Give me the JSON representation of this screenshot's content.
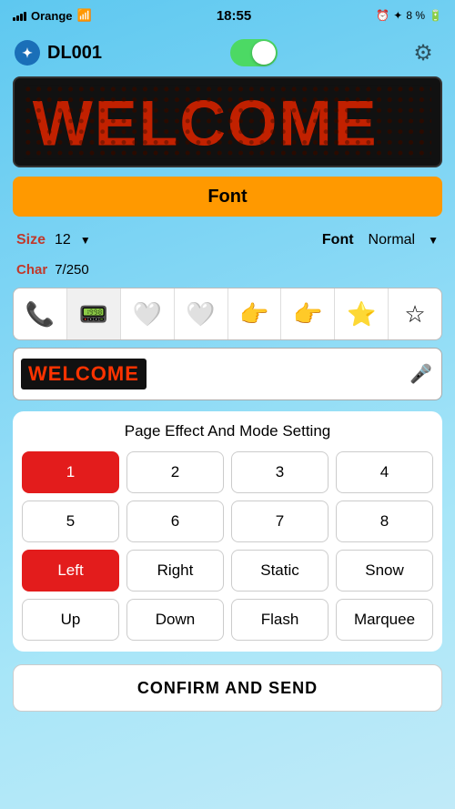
{
  "status": {
    "carrier": "Orange",
    "time": "18:55",
    "battery": "8 %",
    "bt_symbol": "✦"
  },
  "header": {
    "device_name": "DL001",
    "toggle_on": true,
    "gear_label": "⚙"
  },
  "font_button": {
    "label": "Font"
  },
  "options": {
    "size_label": "Size",
    "size_value": "12",
    "font_label": "Font",
    "font_value": "Normal",
    "char_label": "Char",
    "char_value": "7/250"
  },
  "emojis": [
    {
      "symbol": "📞",
      "active": false
    },
    {
      "symbol": "📟",
      "active": true
    },
    {
      "symbol": "🤍",
      "active": false
    },
    {
      "symbol": "🤍",
      "active": false
    },
    {
      "symbol": "👉",
      "active": false
    },
    {
      "symbol": "👉",
      "active": false
    },
    {
      "symbol": "⭐",
      "active": false
    },
    {
      "symbol": "☆",
      "active": false
    }
  ],
  "text_input": {
    "value": "WELCOME",
    "placeholder": ""
  },
  "effect_section": {
    "title": "Page Effect And Mode Setting",
    "buttons": [
      {
        "label": "1",
        "active": true
      },
      {
        "label": "2",
        "active": false
      },
      {
        "label": "3",
        "active": false
      },
      {
        "label": "4",
        "active": false
      },
      {
        "label": "5",
        "active": false
      },
      {
        "label": "6",
        "active": false
      },
      {
        "label": "7",
        "active": false
      },
      {
        "label": "8",
        "active": false
      },
      {
        "label": "Left",
        "active": true
      },
      {
        "label": "Right",
        "active": false
      },
      {
        "label": "Static",
        "active": false
      },
      {
        "label": "Snow",
        "active": false
      },
      {
        "label": "Up",
        "active": false
      },
      {
        "label": "Down",
        "active": false
      },
      {
        "label": "Flash",
        "active": false
      },
      {
        "label": "Marquee",
        "active": false
      }
    ]
  },
  "confirm_button": {
    "label": "CONFIRM AND SEND"
  },
  "colors": {
    "accent_orange": "#ff9900",
    "active_red": "#e31c1c",
    "led_red": "#dd2200",
    "led_bg": "#111111"
  }
}
